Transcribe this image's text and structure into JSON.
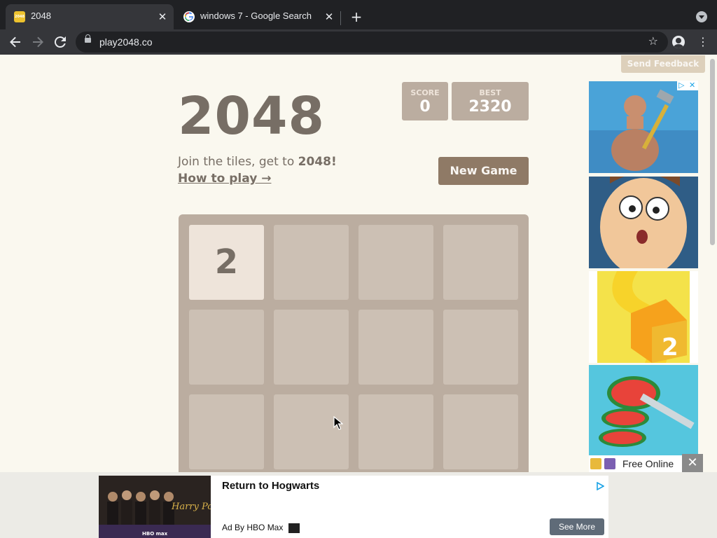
{
  "browser": {
    "tabs": [
      {
        "title": "2048",
        "favicon": "2048-favicon",
        "active": true
      },
      {
        "title": "windows 7 - Google Search",
        "favicon": "google-favicon",
        "active": false
      }
    ],
    "url": "play2048.co",
    "icons": [
      "back-icon",
      "forward-icon",
      "reload-icon",
      "lock-icon",
      "star-icon",
      "profile-icon",
      "menu-icon"
    ]
  },
  "page": {
    "feedback_label": "Send Feedback",
    "title": "2048",
    "score": {
      "label": "SCORE",
      "value": "0"
    },
    "best": {
      "label": "BEST",
      "value": "2320"
    },
    "intro_prefix": "Join the tiles, get to ",
    "intro_bold": "2048!",
    "how_to_play": "How to play →",
    "new_game_label": "New Game",
    "board": {
      "rows_visible": 3,
      "columns": 4,
      "tiles": [
        {
          "row": 0,
          "col": 0,
          "value": "2"
        }
      ]
    }
  },
  "side_ads": {
    "footer_label": "Free Online",
    "close_label": "✕",
    "cards": [
      "hammer-man-game-ad",
      "cartoon-face-game-ad",
      "paper-cube-2-game-ad",
      "watermelon-slice-game-ad"
    ]
  },
  "bottom_ad": {
    "headline": "Return to Hogwarts",
    "byline": "Ad By HBO Max",
    "cta": "See More"
  },
  "colors": {
    "background": "#faf8ef",
    "board": "#bbada0",
    "tile_2": "#eee4da",
    "button": "#8f7a66",
    "text": "#776e65"
  }
}
